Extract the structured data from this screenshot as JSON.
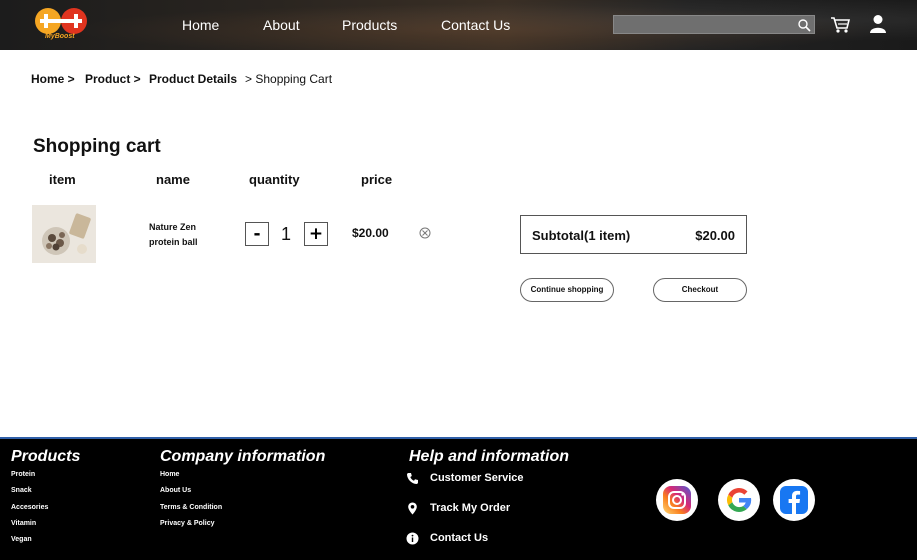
{
  "header": {
    "logo_text": "MyBoost",
    "nav": [
      "Home",
      "About",
      "Products",
      "Contact Us"
    ],
    "search_placeholder": "",
    "icons": [
      "search-icon",
      "cart-icon",
      "user-icon"
    ]
  },
  "breadcrumb": {
    "items": [
      "Home >",
      "Product >",
      "Product Details",
      "> Shopping Cart"
    ]
  },
  "cart": {
    "title": "Shopping cart",
    "columns": [
      "item",
      "name",
      "quantity",
      "price"
    ],
    "item": {
      "name": "Nature Zen protein ball",
      "quantity": "1",
      "minus": "-",
      "plus": "+",
      "price": "$20.00"
    },
    "subtotal_label": "Subtotal(1 item)",
    "subtotal_value": "$20.00",
    "continue_label": "Continue shopping",
    "checkout_label": "Checkout"
  },
  "footer": {
    "products_title": "Products",
    "products": [
      "Protein",
      "Snack",
      "Accesories",
      "Vitamin",
      "Vegan"
    ],
    "company_title": "Company information",
    "company": [
      "Home",
      "About Us",
      "Terms & Condition",
      "Privacy & Policy"
    ],
    "help_title": "Help and information",
    "help": [
      "Customer Service",
      "Track My Order",
      "Contact Us"
    ],
    "social": [
      "instagram-icon",
      "google-icon",
      "facebook-icon"
    ]
  },
  "colors": {
    "footer_bg": "#000000",
    "footer_border": "#2f5fa8",
    "logo_orange": "#f5a623",
    "logo_red": "#e0341f"
  }
}
